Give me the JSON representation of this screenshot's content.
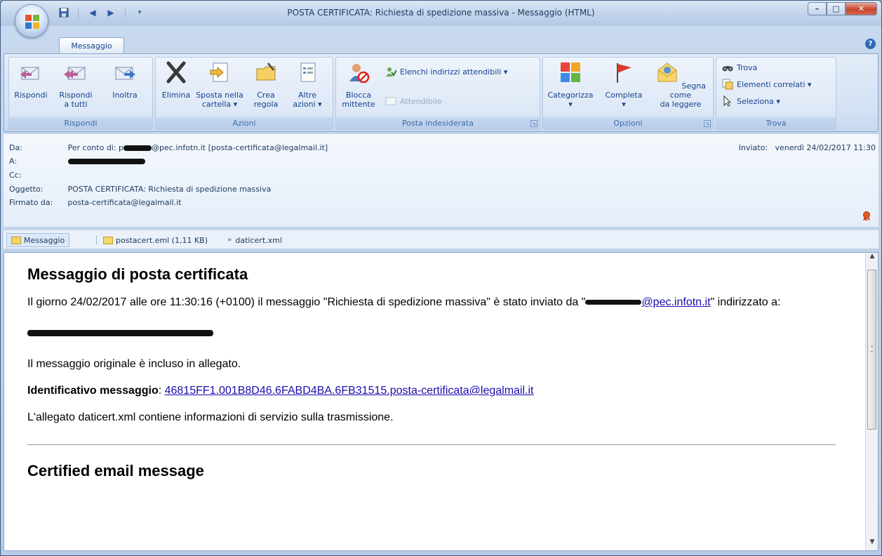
{
  "window": {
    "title": "POSTA CERTIFICATA: Richiesta di spedizione massiva - Messaggio (HTML)"
  },
  "tabs": [
    {
      "label": "Messaggio"
    }
  ],
  "ribbon": {
    "rispondi": {
      "label": "Rispondi",
      "buttons": [
        {
          "label1": "Rispondi",
          "label2": ""
        },
        {
          "label1": "Rispondi",
          "label2": "a tutti"
        },
        {
          "label1": "Inoltra",
          "label2": ""
        }
      ]
    },
    "azioni": {
      "label": "Azioni",
      "buttons": [
        {
          "label1": "Elimina",
          "label2": ""
        },
        {
          "label1": "Sposta nella",
          "label2": "cartella ▾"
        },
        {
          "label1": "Crea",
          "label2": "regola"
        },
        {
          "label1": "Altre",
          "label2": "azioni ▾"
        }
      ]
    },
    "posta": {
      "label": "Posta indesiderata",
      "blocca1": "Blocca",
      "blocca2": "mittente",
      "elenchi": "Elenchi indirizzi attendibili ▾",
      "attendibile": "Attendibile"
    },
    "opzioni": {
      "label": "Opzioni",
      "buttons": [
        {
          "label1": "Categorizza",
          "label2": "▾"
        },
        {
          "label1": "Completa",
          "label2": "▾"
        },
        {
          "label1": "Segna come",
          "label2": "da leggere"
        }
      ]
    },
    "trova": {
      "label": "Trova",
      "trova": "Trova",
      "elementi": "Elementi correlati ▾",
      "seleziona": "Seleziona ▾"
    }
  },
  "header": {
    "da_label": "Da:",
    "da_value_prefix": "Per conto di: p",
    "da_value_suffix": "@pec.infotn.it [posta-certificata@legalmail.it]",
    "a_label": "A:",
    "cc_label": "Cc:",
    "oggetto_label": "Oggetto:",
    "oggetto_value": "POSTA CERTIFICATA: Richiesta di spedizione massiva",
    "firmato_label": "Firmato da:",
    "firmato_value": "posta-certificata@legalmail.it",
    "inviato_label": "Inviato:",
    "inviato_value": "venerdì 24/02/2017 11:30"
  },
  "attachments": [
    {
      "label": "Messaggio"
    },
    {
      "label": "postacert.eml (1,11 KB)"
    },
    {
      "label": "daticert.xml"
    }
  ],
  "body": {
    "title": "Messaggio di posta certificata",
    "p1_text": "Il giorno 24/02/2017 alle ore 11:30:16 (+0100) il messaggio \"Richiesta di spedizione massiva\" è stato inviato da \"",
    "p1_link_suffix": "@pec.infotn.it",
    "p1_end": "\" indirizzato a:",
    "p2": "Il messaggio originale è incluso in allegato.",
    "id_label": "Identificativo messaggio",
    "id_colon": ": ",
    "id_value": "46815FF1.001B8D46.6FABD4BA.6FB31515.posta-certificata@legalmail.it",
    "p4": "L'allegato daticert.xml contiene informazioni di servizio sulla trasmissione.",
    "title2": "Certified email message"
  }
}
